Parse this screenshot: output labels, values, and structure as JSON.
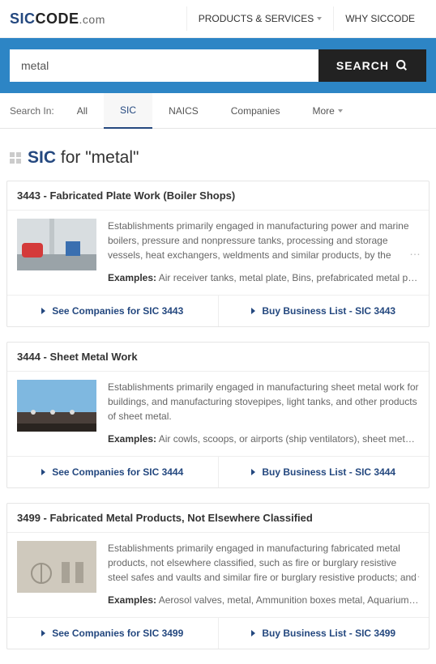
{
  "logo": {
    "part1": "SIC",
    "part2": "CODE",
    "part3": ".com"
  },
  "topnav": {
    "products": "PRODUCTS & SERVICES",
    "why": "WHY SICCODE"
  },
  "search": {
    "value": "metal",
    "button": "SEARCH"
  },
  "tabs": {
    "label": "Search In:",
    "all": "All",
    "sic": "SIC",
    "naics": "NAICS",
    "companies": "Companies",
    "more": "More"
  },
  "heading": {
    "sic": "SIC",
    "rest": "for \"metal\""
  },
  "results": [
    {
      "title": "3443 - Fabricated Plate Work (Boiler Shops)",
      "desc": "Establishments primarily engaged in manufacturing power and marine boilers, pressure and nonpressure tanks, processing and storage vessels, heat exchangers, weldments and similar products, by the process of cutting, forming and joining metal plates,",
      "examples_lead": "Examples:",
      "examples": " Air receiver tanks, metal plate, Bins, prefabricated metal plate, Boxes, cond...",
      "see": "See Companies for SIC 3443",
      "buy": "Buy Business List - SIC 3443"
    },
    {
      "title": "3444 - Sheet Metal Work",
      "desc": "Establishments primarily engaged in manufacturing sheet metal work for buildings, and manufacturing stovepipes, light tanks, and other products of sheet metal.",
      "examples_lead": "Examples:",
      "examples": " Air cowls, scoops, or airports (ship ventilators), sheet metal, Awnings, shee...",
      "see": "See Companies for SIC 3444",
      "buy": "Buy Business List - SIC 3444"
    },
    {
      "title": "3499 - Fabricated Metal Products, Not Elsewhere Classified",
      "desc": "Establishments primarily engaged in manufacturing fabricated metal products, not elsewhere classified, such as fire or burglary resistive steel safes and vaults and similar fire or burglary resistive products; and collapsible tubes of thin flexible metal. Also",
      "examples_lead": "Examples:",
      "examples": " Aerosol valves, metal, Ammunition boxes metal, Aquarium accessories, me...",
      "see": "See Companies for SIC 3499",
      "buy": "Buy Business List - SIC 3499"
    }
  ]
}
